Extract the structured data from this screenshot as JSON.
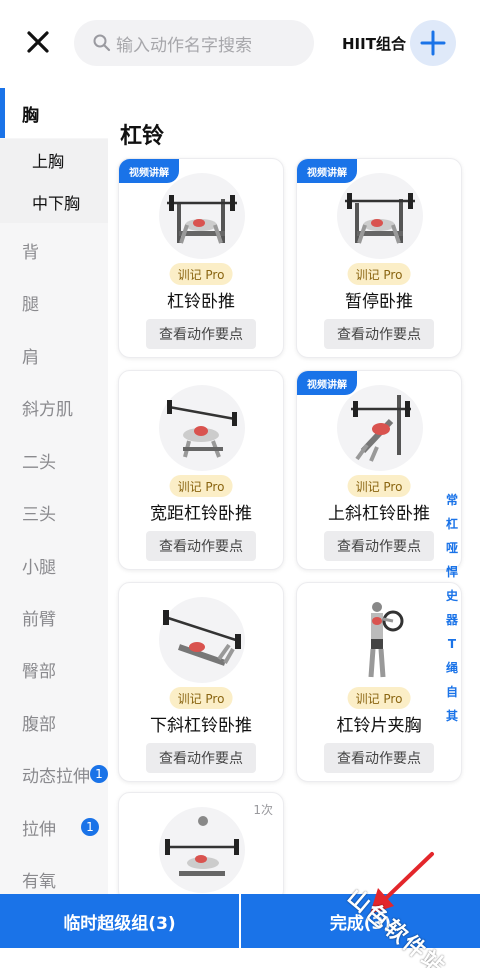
{
  "header": {
    "search_placeholder": "输入动作名字搜索",
    "combo_label": "HIIT组合"
  },
  "sidebar": {
    "items": [
      {
        "label": "胸",
        "active": true
      },
      {
        "label": "背"
      },
      {
        "label": "腿"
      },
      {
        "label": "肩"
      },
      {
        "label": "斜方肌"
      },
      {
        "label": "二头"
      },
      {
        "label": "三头"
      },
      {
        "label": "小腿"
      },
      {
        "label": "前臂"
      },
      {
        "label": "臀部"
      },
      {
        "label": "腹部"
      },
      {
        "label": "动态拉伸",
        "badge": "1"
      },
      {
        "label": "拉伸",
        "badge": "1"
      },
      {
        "label": "有氧"
      }
    ],
    "sub_items": [
      {
        "label": "上胸"
      },
      {
        "label": "中下胸"
      }
    ]
  },
  "main": {
    "section_title": "杠铃",
    "cards": [
      {
        "name": "杠铃卧推",
        "tag": "视频讲解",
        "pro": "训记 Pro",
        "detail": "查看动作要点"
      },
      {
        "name": "暂停卧推",
        "tag": "视频讲解",
        "pro": "训记 Pro",
        "detail": "查看动作要点"
      },
      {
        "name": "宽距杠铃卧推",
        "tag": "",
        "pro": "训记 Pro",
        "detail": "查看动作要点"
      },
      {
        "name": "上斜杠铃卧推",
        "tag": "视频讲解",
        "pro": "训记 Pro",
        "detail": "查看动作要点"
      },
      {
        "name": "下斜杠铃卧推",
        "tag": "",
        "pro": "训记 Pro",
        "detail": "查看动作要点"
      },
      {
        "name": "杠铃片夹胸",
        "tag": "",
        "pro": "训记 Pro",
        "detail": "查看动作要点"
      },
      {
        "name": "",
        "tag": "",
        "count": "1次"
      }
    ]
  },
  "index_bar": [
    "常",
    "杠",
    "哑",
    "悍",
    "史",
    "器",
    "T",
    "绳",
    "自",
    "其"
  ],
  "bottom": {
    "superset_label": "临时超级组(3)",
    "done_label": "完成(3)"
  },
  "watermark": "山色软件站",
  "colors": {
    "accent": "#1a73e8",
    "pro_bg": "#fbeec7",
    "sidebar_bg": "#f6f6f7"
  }
}
